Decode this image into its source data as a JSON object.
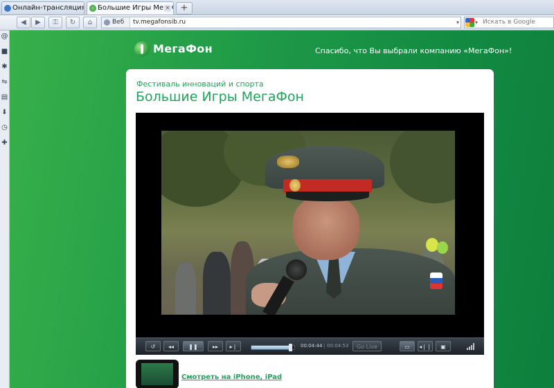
{
  "browser": {
    "tabs": [
      {
        "label": "Онлайн-трансляция ...",
        "active": false,
        "icon": "chat-bubble-icon",
        "icon_color": "#3a78c8"
      },
      {
        "label": "Большие Игры МегаФ...",
        "active": true,
        "icon": "megafon-globe-icon",
        "icon_color": "#3a9a47"
      }
    ],
    "new_tab_label": "+",
    "close_label": "×",
    "address_bar": {
      "site_label": "Веб",
      "url": "tv.megafonsib.ru",
      "dropdown_label": "▾"
    },
    "search": {
      "placeholder": "Искать в Google",
      "engine_icon": "google-icon",
      "dropdown_label": "▾"
    },
    "side_panel": [
      "mail-icon",
      "bookmarks-icon",
      "widgets-icon",
      "transfers-icon",
      "notes-icon",
      "downloads-icon",
      "history-icon",
      "add-panel-icon"
    ]
  },
  "page": {
    "logo_text": "МегаФон",
    "tagline": "Спасибо, что Вы выбрали компанию «МегаФон»!",
    "subtitle": "Фестиваль инноваций и спорта",
    "title": "Большие Игры МегаФон",
    "player": {
      "current_time": "00:04:44",
      "duration": "00:04:53",
      "progress_fraction": 0.9,
      "live_label": "Go Live",
      "buttons": {
        "replay": "↺",
        "rewind": "◂◂",
        "pause": "❚❚",
        "forward": "▸▸",
        "next": "▸❘"
      }
    },
    "iphone_link": "Смотреть на iPhone, iPad"
  },
  "colors": {
    "brand_green": "#1fa25a",
    "page_bg_dark": "#0e7f3d",
    "page_bg_light": "#37b04a"
  }
}
